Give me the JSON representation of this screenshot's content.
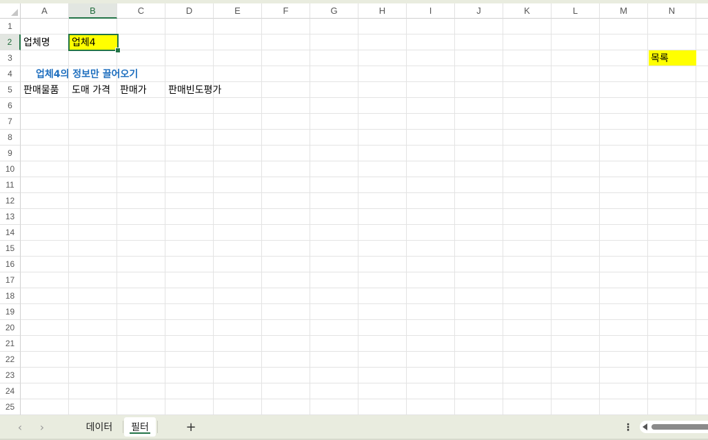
{
  "columns": [
    "A",
    "B",
    "C",
    "D",
    "E",
    "F",
    "G",
    "H",
    "I",
    "J",
    "K",
    "L",
    "M",
    "N"
  ],
  "rows": [
    "1",
    "2",
    "3",
    "4",
    "5",
    "6",
    "7",
    "8",
    "9",
    "10",
    "11",
    "12",
    "13",
    "14",
    "15",
    "16",
    "17",
    "18",
    "19",
    "20",
    "21",
    "22",
    "23",
    "24",
    "25"
  ],
  "selected": {
    "column": "B",
    "row": "2"
  },
  "cells": {
    "a2": "업체명",
    "b2": "업체4",
    "n3": "목록",
    "a4_title": "업체4의 정보만 끌어오기",
    "a5": "판매물품",
    "b5": "도매 가격",
    "c5": "판매가",
    "d5": "판매빈도평가"
  },
  "colors": {
    "highlight": "#ffff00",
    "title": "#1f6fbf",
    "accent": "#217346"
  },
  "sheet_tabs": [
    {
      "label": "데이터",
      "active": false
    },
    {
      "label": "필터",
      "active": true
    }
  ],
  "controls": {
    "prev_sheet": "‹",
    "next_sheet": "›",
    "add_sheet": "+",
    "more": "⋮"
  }
}
